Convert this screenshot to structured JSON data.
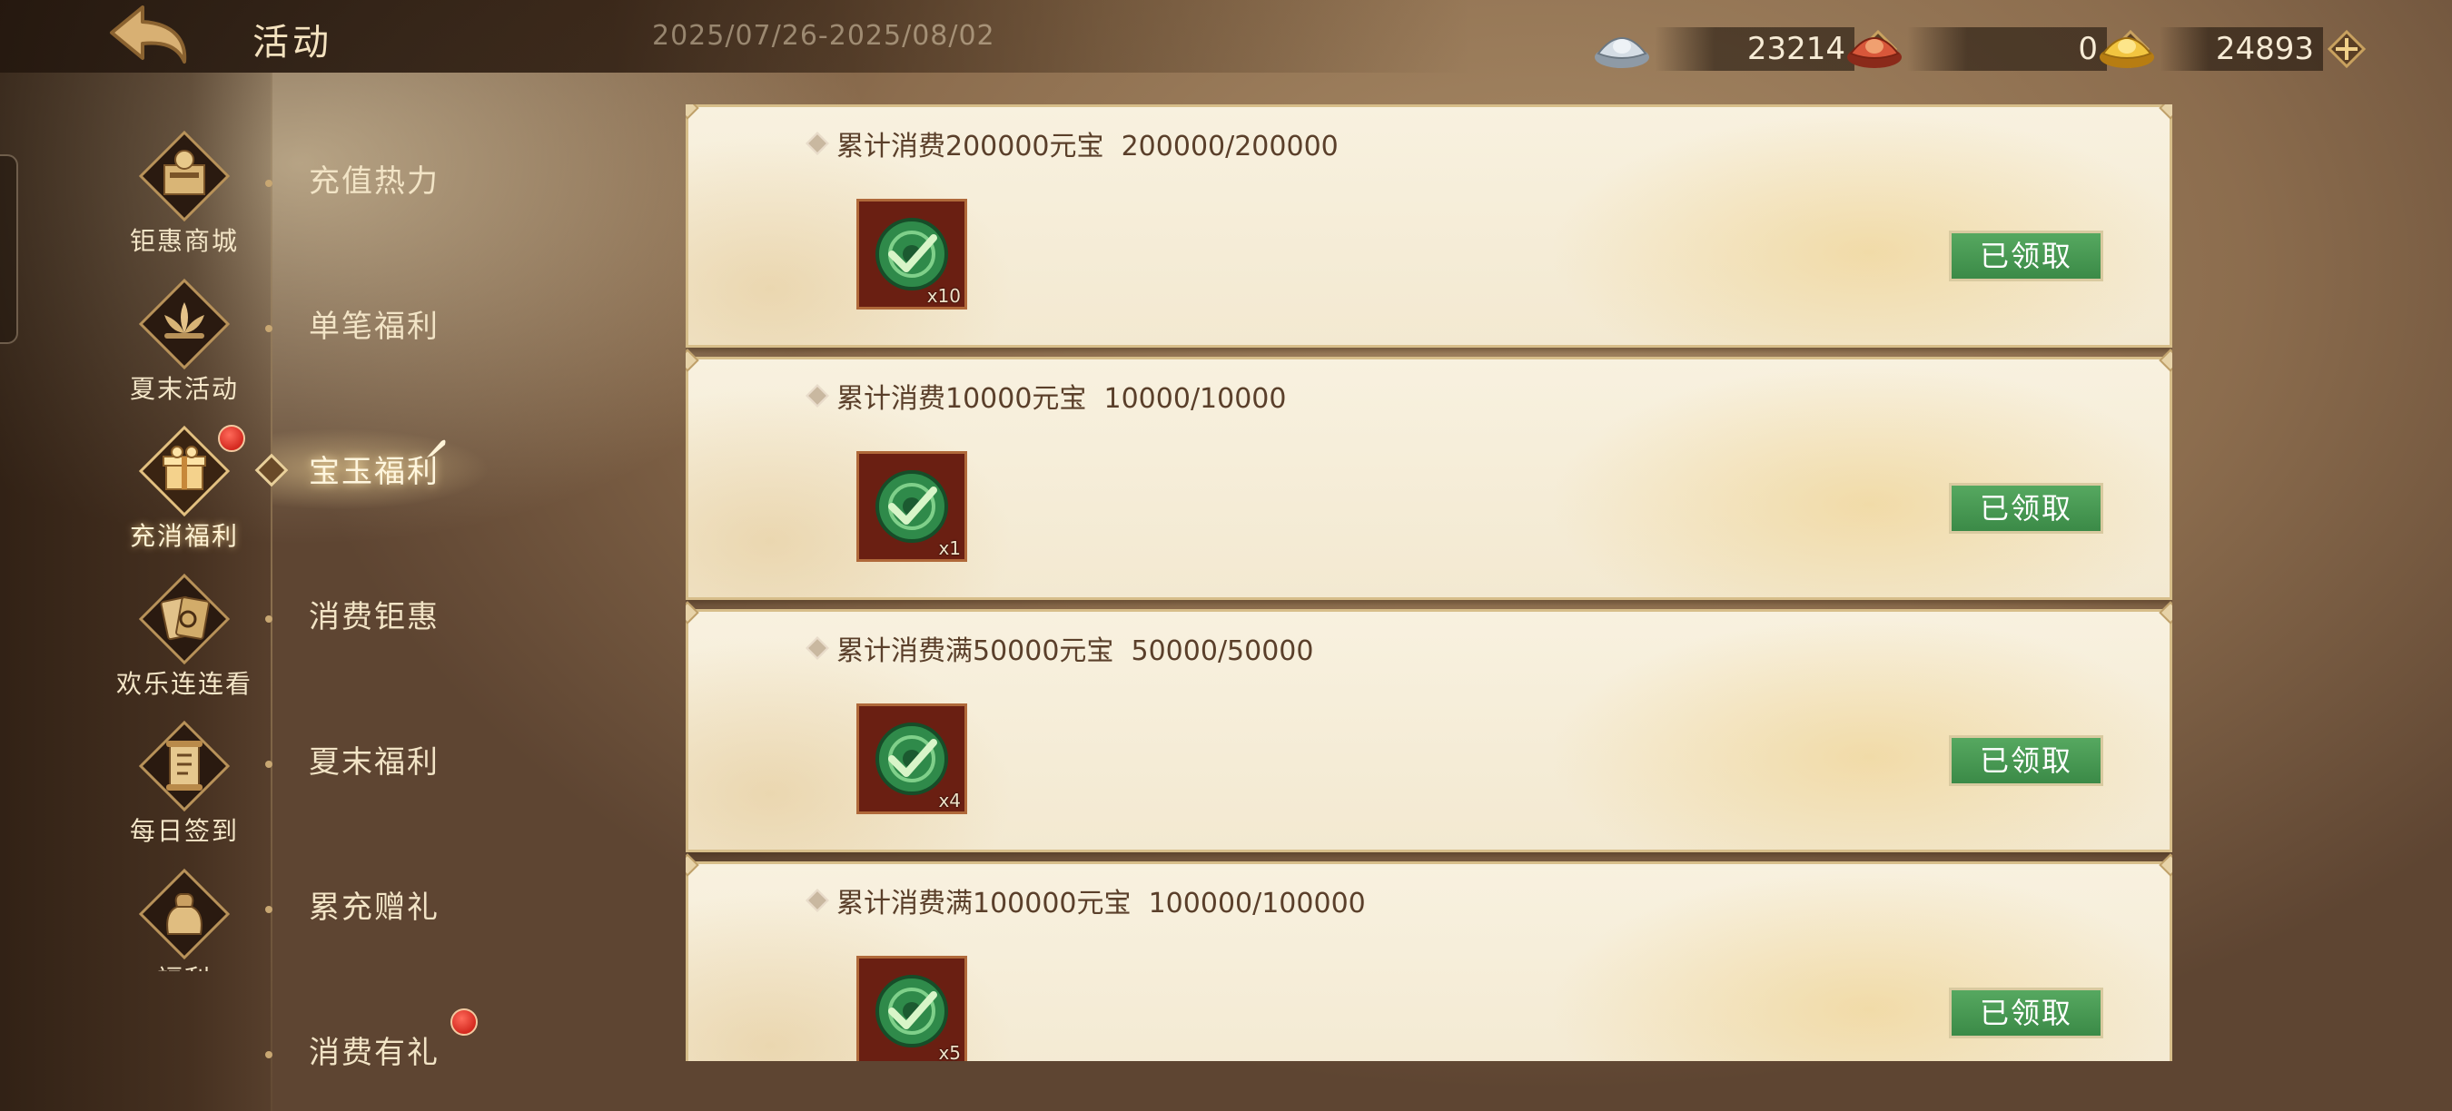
{
  "header": {
    "title": "活动",
    "date_range": "2025/07/26-2025/08/02",
    "currencies": [
      {
        "icon": "silver-ingot-icon",
        "value": "23214"
      },
      {
        "icon": "red-ingot-icon",
        "value": "0"
      },
      {
        "icon": "gold-ingot-icon",
        "value": "24893"
      }
    ]
  },
  "categories": [
    {
      "label": "钜惠商城",
      "icon": "mall-icon"
    },
    {
      "label": "夏末活动",
      "icon": "lotus-icon"
    },
    {
      "label": "充消福利",
      "icon": "gift-box-icon",
      "active": true,
      "badge": true
    },
    {
      "label": "欢乐连连看",
      "icon": "cards-icon"
    },
    {
      "label": "每日签到",
      "icon": "scroll-icon"
    },
    {
      "label": "福利",
      "icon": "bag-icon"
    }
  ],
  "subnav": [
    {
      "label": "充值热力"
    },
    {
      "label": "单笔福利"
    },
    {
      "label": "宝玉福利",
      "active": true
    },
    {
      "label": "消费钜惠"
    },
    {
      "label": "夏末福利"
    },
    {
      "label": "累充赠礼"
    },
    {
      "label": "消费有礼",
      "badge": true
    }
  ],
  "tasks": [
    {
      "title": "累计消费200000元宝  200000/200000",
      "qty": "x10",
      "button": "已领取",
      "reward_icon": "jade-token-icon"
    },
    {
      "title": "累计消费10000元宝  10000/10000",
      "qty": "x1",
      "button": "已领取",
      "reward_icon": "jade-token-icon"
    },
    {
      "title": "累计消费满50000元宝  50000/50000",
      "qty": "x4",
      "button": "已领取",
      "reward_icon": "jade-token-icon"
    },
    {
      "title": "累计消费满100000元宝  100000/100000",
      "qty": "x5",
      "button": "已领取",
      "reward_icon": "jade-token-icon"
    }
  ],
  "colors": {
    "claim_button": "#4a9a55",
    "badge_red": "#d42a20"
  }
}
